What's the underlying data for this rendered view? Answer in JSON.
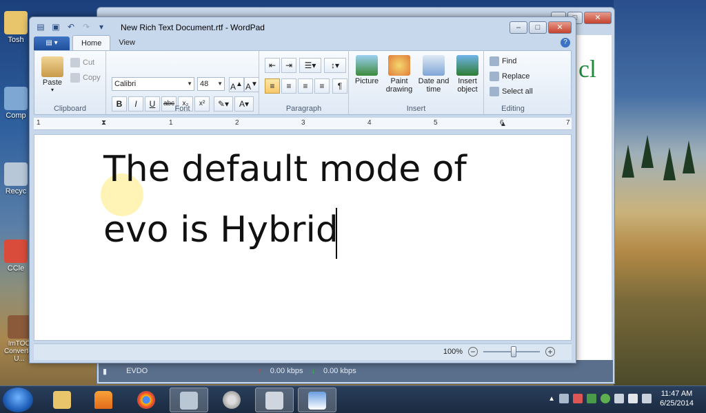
{
  "desktop": {
    "icons": [
      "Tosh",
      "Comp",
      "Recyc",
      "CCle",
      "ImTOO Converter U..."
    ]
  },
  "background_window": {
    "logo_text": "cl",
    "status": {
      "label": "EVDO",
      "upload": "0.00 kbps",
      "download": "0.00 kbps"
    }
  },
  "wordpad": {
    "title": "New Rich Text Document.rtf - WordPad",
    "tabs": [
      "Home",
      "View"
    ],
    "clipboard": {
      "paste": "Paste",
      "cut": "Cut",
      "copy": "Copy",
      "label": "Clipboard"
    },
    "font": {
      "family": "Calibri",
      "size": "48",
      "label": "Font"
    },
    "paragraph": {
      "label": "Paragraph"
    },
    "insert": {
      "picture": "Picture",
      "paint": "Paint drawing",
      "datetime": "Date and time",
      "object": "Insert object",
      "label": "Insert"
    },
    "editing": {
      "find": "Find",
      "replace": "Replace",
      "selectall": "Select all",
      "label": "Editing"
    },
    "ruler": [
      "1",
      "1",
      "2",
      "3",
      "4",
      "5",
      "6",
      "7"
    ],
    "document": {
      "line1": "The default mode of",
      "line2": "evo is Hybrid"
    },
    "zoom": "100%"
  },
  "taskbar": {
    "clock_time": "11:47 AM",
    "clock_date": "6/25/2014"
  }
}
